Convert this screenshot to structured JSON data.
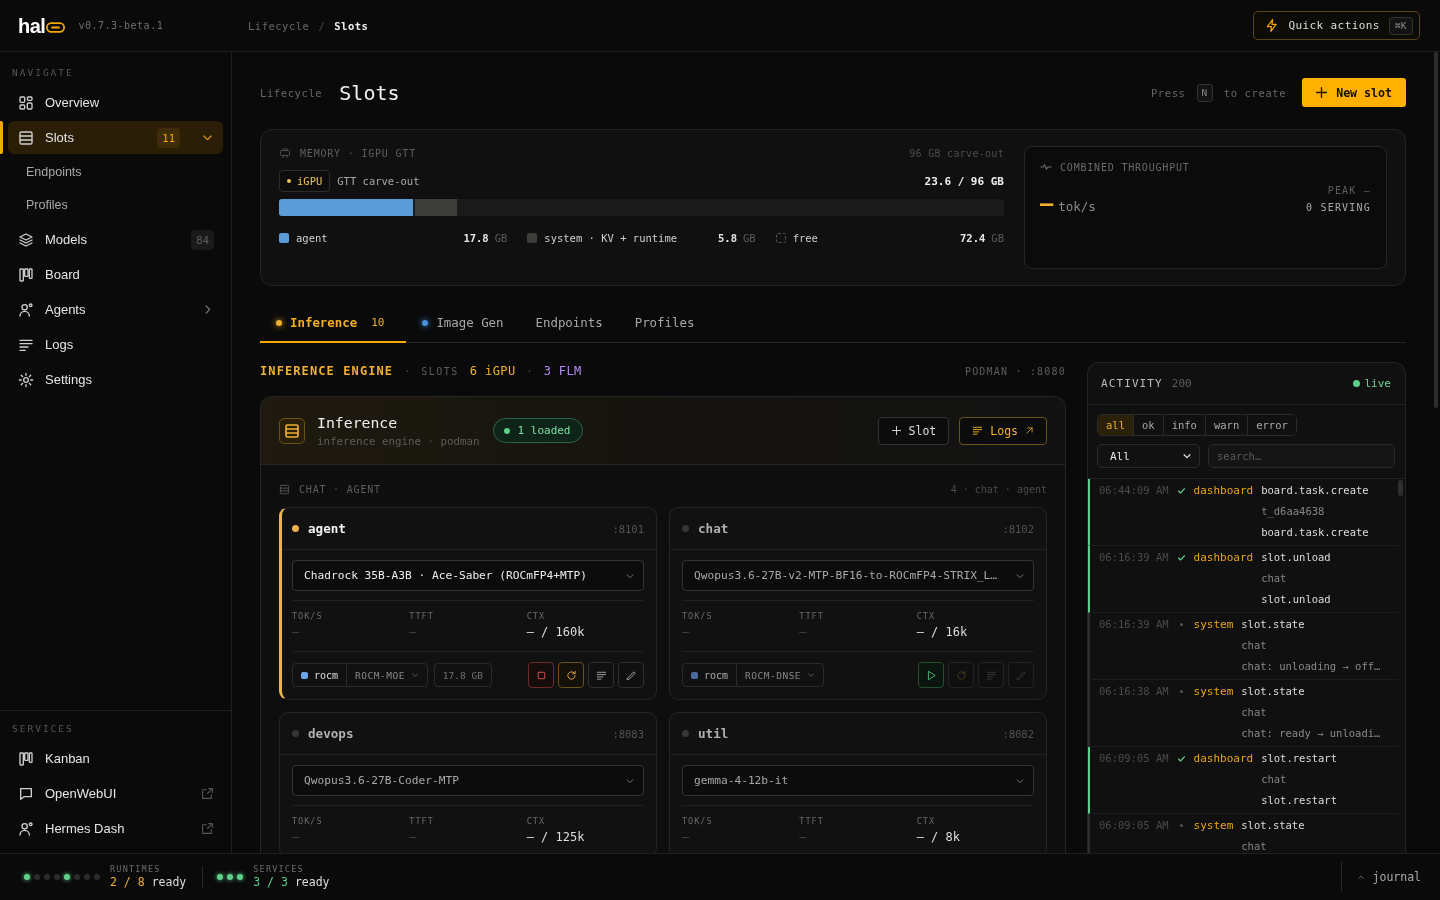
{
  "header": {
    "logo": "hal",
    "version": "v0.7.3-beta.1",
    "breadcrumb": {
      "separator": "/",
      "items": [
        {
          "label": "Lifecycle",
          "current": false
        },
        {
          "label": "Slots",
          "current": true
        }
      ]
    },
    "quick_actions": {
      "label": "Quick actions",
      "shortcut": "⌘K"
    }
  },
  "sidebar": {
    "sections": [
      {
        "title": "NAVIGATE",
        "items": [
          {
            "label": "Overview",
            "kind": "link",
            "selected": false
          },
          {
            "label": "Slots",
            "kind": "group",
            "selected": true,
            "badge": "11",
            "expanded": true,
            "children": [
              {
                "label": "Endpoints",
                "selected": false
              },
              {
                "label": "Profiles",
                "selected": false
              }
            ]
          },
          {
            "label": "Models",
            "kind": "link",
            "selected": false,
            "badge": "84"
          },
          {
            "label": "Board",
            "kind": "link",
            "selected": false
          },
          {
            "label": "Agents",
            "kind": "group",
            "selected": false,
            "expanded": false
          },
          {
            "label": "Logs",
            "kind": "link",
            "selected": false
          },
          {
            "label": "Settings",
            "kind": "link",
            "selected": false
          }
        ]
      },
      {
        "title": "SERVICES",
        "items": [
          {
            "label": "Kanban",
            "kind": "link",
            "selected": false,
            "external": false
          },
          {
            "label": "OpenWebUI",
            "kind": "link",
            "selected": false,
            "external": true
          },
          {
            "label": "Hermes Dash",
            "kind": "link",
            "selected": false,
            "external": true
          }
        ]
      }
    ]
  },
  "page": {
    "eyebrow": "Lifecycle",
    "title": "Slots",
    "hint": {
      "before": "Press",
      "key": "N",
      "after": "to create"
    },
    "primary_button": "New slot"
  },
  "memory": {
    "title": "MEMORY · IGPU GTT",
    "note": "96 GB carve-out",
    "chip": "iGPU",
    "pool": "GTT carve-out",
    "usage": "23.6 / 96 GB",
    "bar": {
      "fills": [
        {
          "level": 0.246,
          "color": "#3c3c39"
        },
        {
          "level": 0.185,
          "color": "#5b9bd8"
        }
      ]
    },
    "legend": [
      {
        "kind": "used",
        "label": "agent",
        "value": "17.8",
        "unit": "GB",
        "color": "#5b9bd8"
      },
      {
        "kind": "used",
        "label": "system · KV + runtime",
        "value": "5.8",
        "unit": "GB",
        "color": "#3c3c39"
      },
      {
        "kind": "free",
        "label": "free",
        "value": "72.4",
        "unit": "GB"
      }
    ]
  },
  "throughput": {
    "title": "COMBINED THROUGHPUT",
    "value": "—",
    "unit": "tok/s",
    "peak": "PEAK —",
    "serving": "0 SERVING"
  },
  "tabs": [
    {
      "label": "Inference",
      "selected": true,
      "color": "#f0b030",
      "count": "10"
    },
    {
      "label": "Image Gen",
      "selected": false,
      "color": "#4a8fe0"
    },
    {
      "label": "Endpoints",
      "selected": false
    },
    {
      "label": "Profiles",
      "selected": false
    }
  ],
  "engine": {
    "header": [
      {
        "kind": "title",
        "text": "INFERENCE ENGINE"
      },
      {
        "kind": "sep",
        "text": "·"
      },
      {
        "kind": "label",
        "text": "SLOTS"
      },
      {
        "kind": "count",
        "text": "6 iGPU",
        "color": "#f0b030"
      },
      {
        "kind": "sep",
        "text": "·"
      },
      {
        "kind": "count",
        "text": "3 FLM",
        "color": "#b48cf5"
      }
    ],
    "host": "PODMAN · :8080",
    "name": "Inference",
    "subtitle": "inference engine · podman",
    "status": "1 loaded",
    "buttons": [
      {
        "label": "Slot",
        "kind": "add"
      },
      {
        "label": "Logs",
        "kind": "logs"
      }
    ],
    "group": {
      "title": "CHAT · AGENT",
      "summary": "4 · chat · agent",
      "slots": [
        {
          "name": "agent",
          "port": ":8101",
          "loaded": true,
          "model": "Chadrock 35B-A3B · Ace-Saber (ROCmFP4+MTP)",
          "metrics": [
            {
              "label": "TOK/S",
              "value": "—",
              "muted": true
            },
            {
              "label": "TTFT",
              "value": "—",
              "muted": true
            },
            {
              "label": "CTX",
              "value": "— / 160k",
              "muted": false
            }
          ],
          "runtime": {
            "name": "rocm",
            "variant": "ROCM-MOE",
            "color": "#6aa6ee",
            "size": "17.8 GB"
          },
          "actions": [
            {
              "kind": "stop",
              "disabled": false
            },
            {
              "kind": "restart",
              "disabled": false
            },
            {
              "kind": "logs",
              "disabled": false
            },
            {
              "kind": "edit",
              "disabled": false
            }
          ]
        },
        {
          "name": "chat",
          "port": ":8102",
          "loaded": false,
          "model": "Qwopus3.6-27B-v2-MTP-BF16-to-ROCmFP4-STRIX_L…",
          "metrics": [
            {
              "label": "TOK/S",
              "value": "—",
              "muted": true
            },
            {
              "label": "TTFT",
              "value": "—",
              "muted": true
            },
            {
              "label": "CTX",
              "value": "— / 16k",
              "muted": false
            }
          ],
          "runtime": {
            "name": "rocm",
            "variant": "ROCM-DNSE",
            "color": "#4a6a9c"
          },
          "actions": [
            {
              "kind": "play",
              "disabled": false
            },
            {
              "kind": "restart",
              "disabled": true
            },
            {
              "kind": "logs",
              "disabled": true
            },
            {
              "kind": "edit",
              "disabled": true
            }
          ]
        },
        {
          "name": "devops",
          "port": ":8083",
          "loaded": false,
          "model": "Qwopus3.6-27B-Coder-MTP",
          "metrics": [
            {
              "label": "TOK/S",
              "value": "—",
              "muted": true
            },
            {
              "label": "TTFT",
              "value": "—",
              "muted": true
            },
            {
              "label": "CTX",
              "value": "— / 125k",
              "muted": false
            }
          ]
        },
        {
          "name": "util",
          "port": ":8082",
          "loaded": false,
          "model": "gemma-4-12b-it",
          "metrics": [
            {
              "label": "TOK/S",
              "value": "—",
              "muted": true
            },
            {
              "label": "TTFT",
              "value": "—",
              "muted": true
            },
            {
              "label": "CTX",
              "value": "— / 8k",
              "muted": false
            }
          ]
        }
      ]
    }
  },
  "activity": {
    "title": "ACTIVITY",
    "count": "200",
    "live": {
      "label": "live",
      "on": true
    },
    "filters": [
      {
        "label": "all",
        "selected": true
      },
      {
        "label": "ok",
        "selected": false
      },
      {
        "label": "info",
        "selected": false
      },
      {
        "label": "warn",
        "selected": false
      },
      {
        "label": "error",
        "selected": false
      }
    ],
    "source_select": "All",
    "search_placeholder": "search…",
    "entries": [
      {
        "time": "06:44:09 AM",
        "ok": true,
        "source": "dashboard",
        "event": "board.task.create",
        "subject": "t_d6aa4638",
        "message": "board.task.create"
      },
      {
        "time": "06:16:39 AM",
        "ok": true,
        "source": "dashboard",
        "event": "slot.unload",
        "subject": "chat",
        "message": "slot.unload"
      },
      {
        "time": "06:16:39 AM",
        "ok": false,
        "source": "system",
        "event": "slot.state",
        "subject": "chat",
        "message": "chat: unloading → off…"
      },
      {
        "time": "06:16:38 AM",
        "ok": false,
        "source": "system",
        "event": "slot.state",
        "subject": "chat",
        "message": "chat: ready → unloadi…"
      },
      {
        "time": "06:09:05 AM",
        "ok": true,
        "source": "dashboard",
        "event": "slot.restart",
        "subject": "chat",
        "message": "slot.restart"
      },
      {
        "time": "06:09:05 AM",
        "ok": false,
        "source": "system",
        "event": "slot.state",
        "subject": "chat"
      }
    ]
  },
  "status_bar": {
    "groups": [
      {
        "label": "RUNTIMES",
        "count": "2 / 8",
        "status": "ready",
        "color": "#f0b030",
        "dots": [
          {
            "on": true
          },
          {
            "on": false
          },
          {
            "on": false
          },
          {
            "on": false
          },
          {
            "on": true
          },
          {
            "on": false
          },
          {
            "on": false
          },
          {
            "on": false
          }
        ]
      },
      {
        "label": "SERVICES",
        "count": "3 / 3",
        "status": "ready",
        "color": "#5fd08a",
        "dots": [
          {
            "on": true
          },
          {
            "on": true
          },
          {
            "on": true
          }
        ]
      }
    ],
    "journal": {
      "label": "journal",
      "expanded": false
    }
  }
}
